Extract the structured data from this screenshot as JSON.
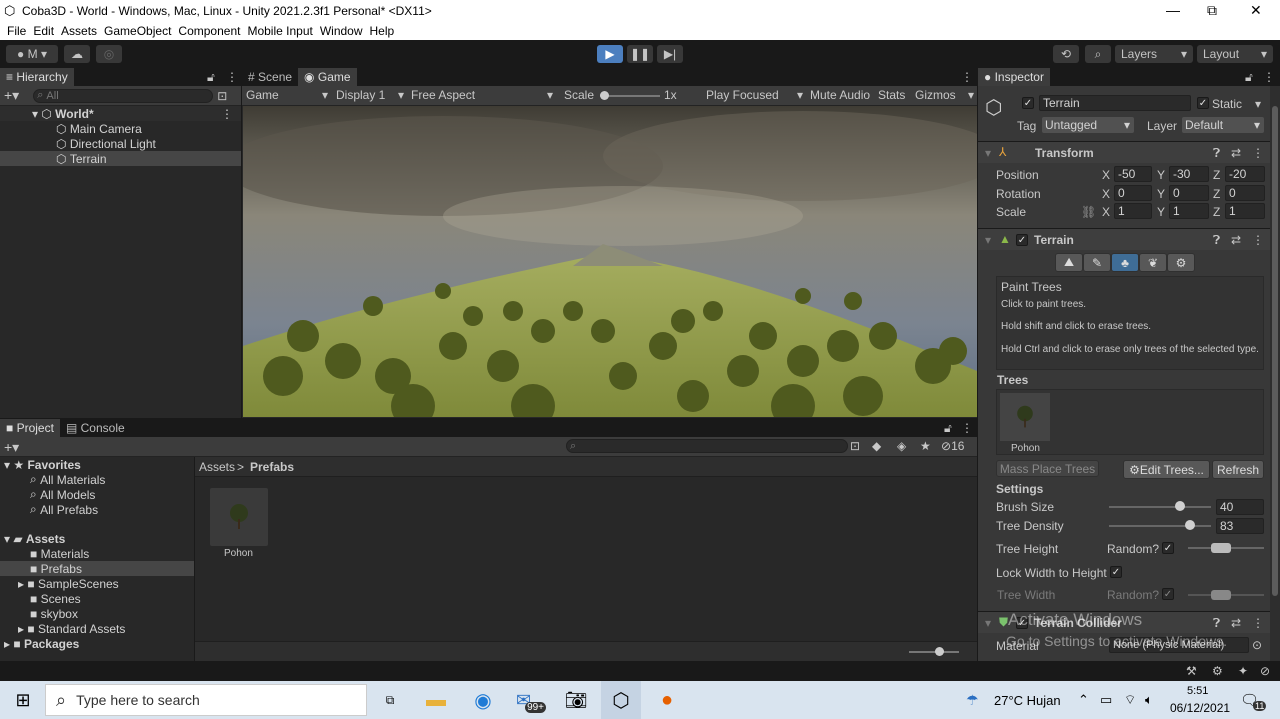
{
  "window": {
    "title": "Coba3D - World - Windows, Mac, Linux - Unity 2021.2.3f1 Personal* <DX11>",
    "minimize": "—",
    "restore": "⧉",
    "close": "✕"
  },
  "menu": [
    "File",
    "Edit",
    "Assets",
    "GameObject",
    "Component",
    "Mobile Input",
    "Window",
    "Help"
  ],
  "toolbar": {
    "account": "M",
    "layers": "Layers",
    "layout": "Layout"
  },
  "hierarchy": {
    "tab": "Hierarchy",
    "search_placeholder": "All",
    "root": "World*",
    "items": [
      "Main Camera",
      "Directional Light",
      "Terrain"
    ]
  },
  "scene_tabs": {
    "scene": "Scene",
    "game": "Game"
  },
  "game_bar": {
    "mode": "Game",
    "display": "Display 1",
    "aspect": "Free Aspect",
    "scale_label": "Scale",
    "scale_value": "1x",
    "play_focused": "Play Focused",
    "mute": "Mute Audio",
    "stats": "Stats",
    "gizmos": "Gizmos"
  },
  "project": {
    "tab_project": "Project",
    "tab_console": "Console",
    "hidden_count": "16",
    "breadcrumb_root": "Assets",
    "breadcrumb_sep": ">",
    "breadcrumb_leaf": "Prefabs",
    "favorites_label": "Favorites",
    "favorites": [
      "All Materials",
      "All Models",
      "All Prefabs"
    ],
    "assets_label": "Assets",
    "folders": [
      "Materials",
      "Prefabs",
      "SampleScenes",
      "Scenes",
      "skybox",
      "Standard Assets"
    ],
    "packages_label": "Packages",
    "asset_item": "Pohon"
  },
  "inspector": {
    "tab": "Inspector",
    "object_name": "Terrain",
    "static_label": "Static",
    "tag_label": "Tag",
    "tag_value": "Untagged",
    "layer_label": "Layer",
    "layer_value": "Default",
    "transform": {
      "title": "Transform",
      "position_label": "Position",
      "px": "-50",
      "py": "-30",
      "pz": "-20",
      "rotation_label": "Rotation",
      "rx": "0",
      "ry": "0",
      "rz": "0",
      "scale_label": "Scale",
      "sx": "1",
      "sy": "1",
      "sz": "1"
    },
    "terrain": {
      "title": "Terrain",
      "paint_title": "Paint Trees",
      "help1": "Click to paint trees.",
      "help2": "Hold shift and click to erase trees.",
      "help3": "Hold Ctrl and click to erase only trees of the selected type.",
      "trees_label": "Trees",
      "tree_item": "Pohon",
      "mass_place": "Mass Place Trees",
      "edit_trees": "Edit Trees...",
      "refresh": "Refresh",
      "settings_label": "Settings",
      "brush_size_label": "Brush Size",
      "brush_size": "40",
      "tree_density_label": "Tree Density",
      "tree_density": "83",
      "tree_height_label": "Tree Height",
      "random_label": "Random?",
      "lock_label": "Lock Width to Height",
      "tree_width_label": "Tree Width",
      "random2_label": "Random?"
    },
    "collider": {
      "title": "Terrain Collider",
      "material_label": "Material",
      "material_value": "None (Physic Material)"
    },
    "watermark1": "Activate Windows",
    "watermark2": "Go to Settings to activate Windows."
  },
  "taskbar": {
    "search_placeholder": "Type here to search",
    "mail_badge": "99+",
    "weather": "27°C  Hujan",
    "time": "5:51",
    "date": "06/12/2021",
    "notif": "11"
  },
  "colors": {
    "accent": "#2c5d87",
    "play": "#4c7fbf",
    "panel": "#282828",
    "header": "#3c3c3c"
  }
}
